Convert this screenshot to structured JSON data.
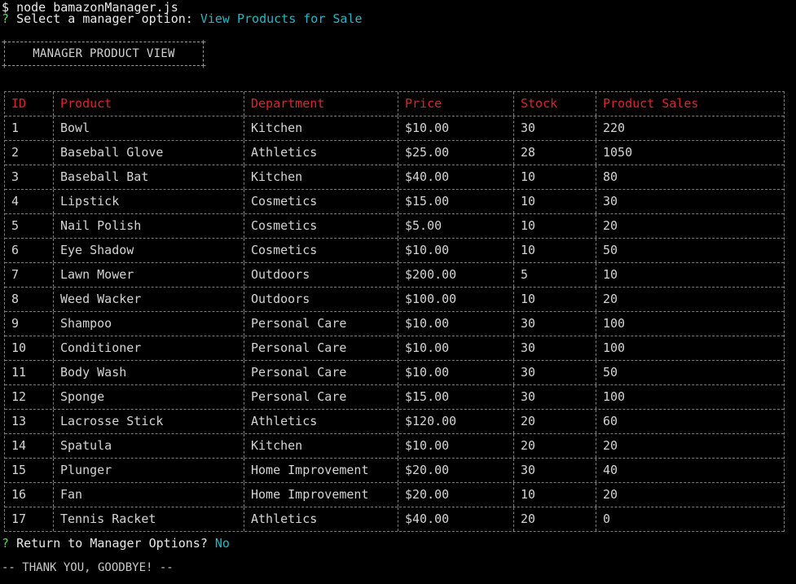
{
  "terminal": {
    "command_prompt": "$",
    "command": "node bamazonManager.js",
    "q1_mark": "?",
    "q1_text": "Select a manager option:",
    "q1_answer": "View Products for Sale",
    "title": "MANAGER PRODUCT VIEW",
    "q2_mark": "?",
    "q2_text": "Return to Manager Options?",
    "q2_answer": "No",
    "goodbye": "-- THANK YOU, GOODBYE! --",
    "colors": {
      "background": "#000000",
      "text": "#d3d3d3",
      "prompt_mark": "#5fd35f",
      "answer": "#22b8c4",
      "header": "#d9262b"
    }
  },
  "table": {
    "headers": [
      "ID",
      "Product",
      "Department",
      "Price",
      "Stock",
      "Product Sales"
    ],
    "rows": [
      [
        "1",
        "Bowl",
        "Kitchen",
        "$10.00",
        "30",
        "220"
      ],
      [
        "2",
        "Baseball Glove",
        "Athletics",
        "$25.00",
        "28",
        "1050"
      ],
      [
        "3",
        "Baseball Bat",
        "Kitchen",
        "$40.00",
        "10",
        "80"
      ],
      [
        "4",
        "Lipstick",
        "Cosmetics",
        "$15.00",
        "10",
        "30"
      ],
      [
        "5",
        "Nail Polish",
        "Cosmetics",
        "$5.00",
        "10",
        "20"
      ],
      [
        "6",
        "Eye Shadow",
        "Cosmetics",
        "$10.00",
        "10",
        "50"
      ],
      [
        "7",
        "Lawn Mower",
        "Outdoors",
        "$200.00",
        "5",
        "10"
      ],
      [
        "8",
        "Weed Wacker",
        "Outdoors",
        "$100.00",
        "10",
        "20"
      ],
      [
        "9",
        "Shampoo",
        "Personal Care",
        "$10.00",
        "30",
        "100"
      ],
      [
        "10",
        "Conditioner",
        "Personal Care",
        "$10.00",
        "30",
        "100"
      ],
      [
        "11",
        "Body Wash",
        "Personal Care",
        "$10.00",
        "30",
        "50"
      ],
      [
        "12",
        "Sponge",
        "Personal Care",
        "$15.00",
        "30",
        "100"
      ],
      [
        "13",
        "Lacrosse Stick",
        "Athletics",
        "$120.00",
        "20",
        "60"
      ],
      [
        "14",
        "Spatula",
        "Kitchen",
        "$10.00",
        "20",
        "20"
      ],
      [
        "15",
        "Plunger",
        "Home Improvement",
        "$20.00",
        "30",
        "40"
      ],
      [
        "16",
        "Fan",
        "Home Improvement",
        "$20.00",
        "10",
        "20"
      ],
      [
        "17",
        "Tennis Racket",
        "Athletics",
        "$40.00",
        "20",
        "0"
      ]
    ]
  }
}
